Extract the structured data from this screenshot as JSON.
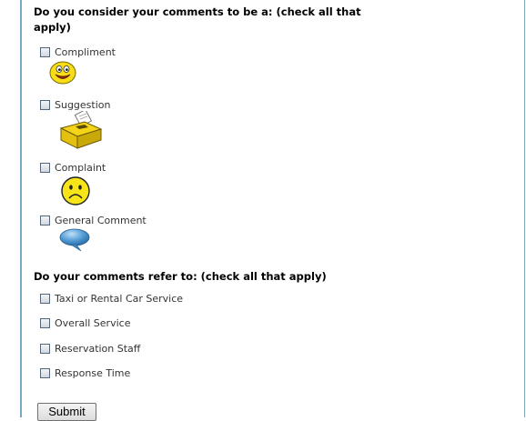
{
  "section1": {
    "heading": "Do you consider your comments to be a: (check all that apply)",
    "options": [
      {
        "label": "Compliment",
        "icon": "smiley-face-icon"
      },
      {
        "label": "Suggestion",
        "icon": "suggestion-box-icon"
      },
      {
        "label": "Complaint",
        "icon": "sad-face-icon"
      },
      {
        "label": "General Comment",
        "icon": "speech-bubble-icon"
      }
    ]
  },
  "section2": {
    "heading": "Do your comments refer to: (check all that apply)",
    "options": [
      {
        "label": "Taxi or Rental Car Service"
      },
      {
        "label": "Overall Service"
      },
      {
        "label": "Reservation Staff"
      },
      {
        "label": "Response Time"
      }
    ]
  },
  "form": {
    "submit_label": "Submit"
  },
  "colors": {
    "frame_border": "#7aa7c2",
    "icon_yellow": "#f7dc16",
    "bubble_blue": "#4f9ad4"
  }
}
